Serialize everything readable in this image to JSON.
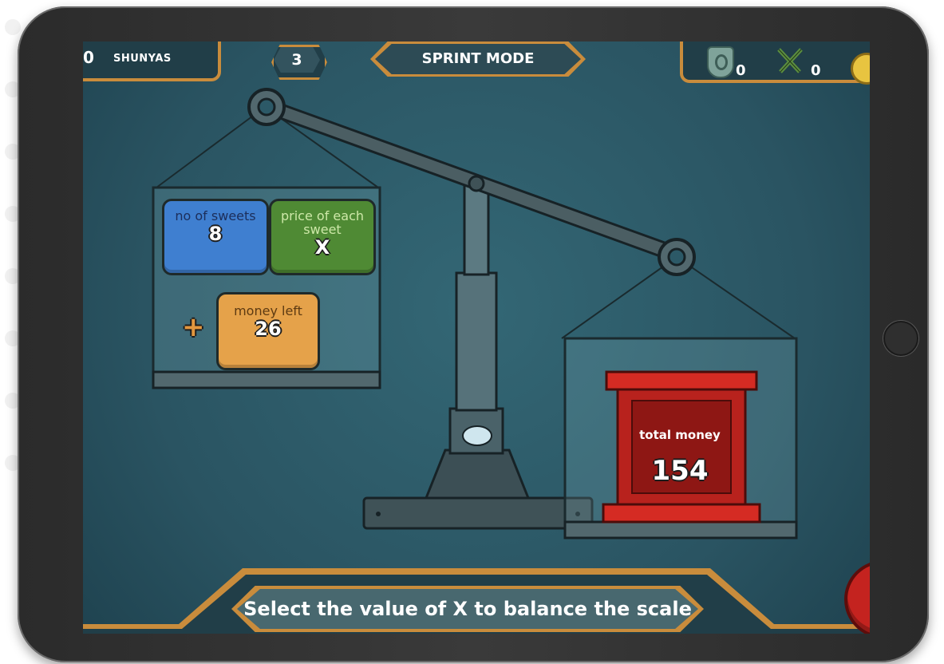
{
  "hud": {
    "score": "0",
    "currency_label": "SHUNYAS",
    "level": "3",
    "mode": "SPRINT MODE",
    "shields": "0",
    "swords": "0"
  },
  "left_pan": {
    "tile1": {
      "label": "no of sweets",
      "value": "8",
      "color": "#3f7fd0"
    },
    "tile2": {
      "label": "price of each sweet",
      "value": "X",
      "color": "#4f8a34"
    },
    "operator": "+",
    "tile3": {
      "label": "money left",
      "value": "26",
      "color": "#e5a24a"
    }
  },
  "right_pan": {
    "label": "total money",
    "value": "154",
    "color": "#c4231f"
  },
  "instruction": "Select the value of X to balance the scale",
  "colors": {
    "background": "#2c5967",
    "frame": "#c98c3c",
    "panel": "#213e48"
  }
}
